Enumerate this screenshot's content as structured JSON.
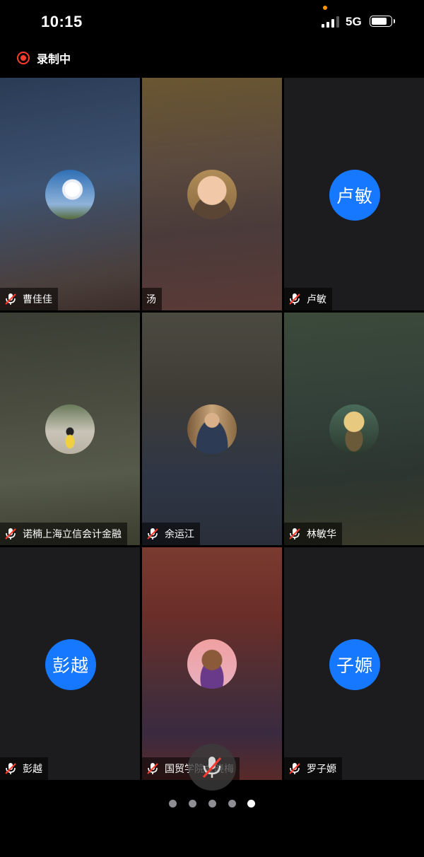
{
  "status_bar": {
    "time": "10:15",
    "network": "5G"
  },
  "recording": {
    "label": "录制中"
  },
  "participants": [
    {
      "name": "曹佳佳",
      "mic_muted": true,
      "avatar": "lotus-photo-avatar"
    },
    {
      "name": "汤",
      "mic_muted": false,
      "avatar": "cartoon-boy-avatar"
    },
    {
      "name": "卢敏",
      "mic_muted": true,
      "avatar_text": "卢敏"
    },
    {
      "name": "诺楠上海立信会计金融",
      "mic_muted": true,
      "avatar": "girl-photo-avatar"
    },
    {
      "name": "余运江",
      "mic_muted": true,
      "avatar": "man-reading-avatar"
    },
    {
      "name": "林敏华",
      "mic_muted": true,
      "avatar": "flower-pot-avatar"
    },
    {
      "name": "彭越",
      "mic_muted": true,
      "avatar_text": "彭越"
    },
    {
      "name": "国贸学院金晓梅",
      "mic_muted": true,
      "avatar": "cartoon-character-avatar"
    },
    {
      "name": "罗子嫄",
      "mic_muted": true,
      "avatar_text": "子嫄"
    }
  ],
  "pager": {
    "pages": 5,
    "current": 5
  },
  "colors": {
    "accent": "#1677ff",
    "recording": "#ff3b30",
    "muted": "#ff3b30"
  }
}
